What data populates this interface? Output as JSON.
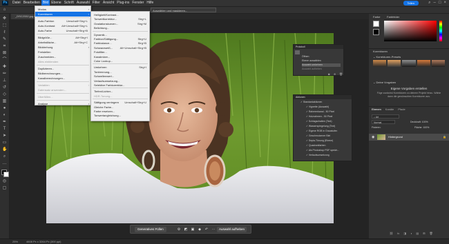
{
  "menubar": {
    "items": [
      "Datei",
      "Bearbeiten",
      "Bild",
      "Ebene",
      "Schrift",
      "Auswahl",
      "Filter",
      "Ansicht",
      "Plug-ins",
      "Fenster",
      "Hilfe"
    ],
    "active_index": 2,
    "share_label": "Teilen",
    "logo": "Ps"
  },
  "options": {
    "select_label": "Auswählen und maskieren..."
  },
  "document": {
    "tab_label": "_DSC2332.jpg @ 25%"
  },
  "image_menu": {
    "items": [
      {
        "label": "Modus",
        "shortcut": "",
        "arrow": true,
        "state": "normal"
      },
      {
        "label": "Korrekturen",
        "shortcut": "",
        "arrow": true,
        "state": "highlight"
      },
      {
        "label": "Auto-Farbton",
        "shortcut": "Umschalt+Strg+L",
        "state": "normal"
      },
      {
        "label": "Auto-Kontrast",
        "shortcut": "Alt+Umschalt+Strg+L",
        "state": "normal"
      },
      {
        "label": "Auto-Farbe",
        "shortcut": "Umschalt+Strg+B",
        "state": "normal"
      },
      {
        "label": "Bildgröße...",
        "shortcut": "Alt+Strg+I",
        "state": "normal"
      },
      {
        "label": "Arbeitsfläche...",
        "shortcut": "Alt+Strg+C",
        "state": "normal"
      },
      {
        "label": "Bilddrehung",
        "shortcut": "",
        "arrow": true,
        "state": "normal"
      },
      {
        "label": "Freistellen",
        "shortcut": "",
        "state": "normal"
      },
      {
        "label": "Zuschneiden...",
        "shortcut": "",
        "state": "normal"
      },
      {
        "label": "Alles einblenden",
        "shortcut": "",
        "state": "disabled"
      },
      {
        "label": "Duplizieren...",
        "shortcut": "",
        "state": "normal"
      },
      {
        "label": "Bildberechnungen...",
        "shortcut": "",
        "state": "normal"
      },
      {
        "label": "Kanalberechnungen...",
        "shortcut": "",
        "state": "normal"
      },
      {
        "label": "Variablen",
        "shortcut": "",
        "arrow": true,
        "state": "disabled"
      },
      {
        "label": "Datensatz anwenden...",
        "shortcut": "",
        "state": "disabled"
      },
      {
        "label": "Überfüllen...",
        "shortcut": "",
        "state": "disabled"
      },
      {
        "label": "Analyse",
        "shortcut": "",
        "arrow": true,
        "state": "normal"
      }
    ]
  },
  "adjust_menu": {
    "items": [
      {
        "label": "Helligkeit/Kontrast...",
        "shortcut": ""
      },
      {
        "label": "Tonwertkorrektur...",
        "shortcut": "Strg+L"
      },
      {
        "label": "Gradationskurven...",
        "shortcut": "Strg+M"
      },
      {
        "label": "Belichtung...",
        "shortcut": ""
      },
      {
        "label": "Dynamik...",
        "shortcut": ""
      },
      {
        "label": "Farbton/Sättigung...",
        "shortcut": "Strg+U"
      },
      {
        "label": "Farbbalance...",
        "shortcut": "Strg+B"
      },
      {
        "label": "Schwarzweiß...",
        "shortcut": "Alt+Umschalt+Strg+B"
      },
      {
        "label": "Fotofilter...",
        "shortcut": ""
      },
      {
        "label": "Kanalmixer...",
        "shortcut": ""
      },
      {
        "label": "Color Lookup...",
        "shortcut": ""
      },
      {
        "label": "Umkehren",
        "shortcut": "Strg+I"
      },
      {
        "label": "Tontrennung...",
        "shortcut": ""
      },
      {
        "label": "Schwellenwert...",
        "shortcut": ""
      },
      {
        "label": "Verlaufsumsetzung...",
        "shortcut": ""
      },
      {
        "label": "Selektive Farbkorrektur...",
        "shortcut": ""
      },
      {
        "label": "Tiefen/Lichter...",
        "shortcut": ""
      },
      {
        "label": "HDR-Tonung...",
        "shortcut": ""
      },
      {
        "label": "Sättigung verringern",
        "shortcut": "Umschalt+Strg+U"
      },
      {
        "label": "Gleiche Farbe...",
        "shortcut": ""
      },
      {
        "label": "Farbe ersetzen...",
        "shortcut": ""
      },
      {
        "label": "Tonwertangleichung...",
        "shortcut": ""
      }
    ]
  },
  "protocol_panel": {
    "title": "Protokoll",
    "rows": [
      "Öffnen",
      "Ebene auswählen",
      "Auswahl umkehren",
      "Auswahl aufheben"
    ]
  },
  "actions_panel": {
    "title": "Aktionen",
    "rows": [
      "Standardaktionen",
      "Vignette (Auswahl)",
      "Rahmenkanal - 50 Pixel",
      "Holzrahmen - 50 Pixel",
      "Schlagschatten (Text)",
      "Wasserspiegelung (Text)",
      "Eigene RGB in Graustufen",
      "Geschmolzener Blei",
      "Sepia-Tönung (Ebene)",
      "Quadrantfarben",
      "Als Photoshop PDF speich...",
      "Verlaufsumsetzung"
    ]
  },
  "dock": {
    "color_tab": "Farbe",
    "swatch_tab": "Farbfelder",
    "corrections_tab": "Korrekturen",
    "presets_label": "Korrekturen-Presets",
    "own_presets_label": "Deine Vorgaben",
    "own_presets_title": "Eigene Vorgaben erstellen",
    "own_presets_text": "Füge zunächst Korrekturen zu deinem Projekt hinzu. Wähle dann die gewünschten Korrekturen aus.",
    "layers_tabs": [
      "Ebenen",
      "Kanäle",
      "Pfade"
    ],
    "kind_label": "Art",
    "blend_mode": "Normal",
    "opacity_label": "Deckkraft: 100%",
    "fill_label": "Fläche: 100%",
    "lock_label": "Fixieren:",
    "layer_name": "Hintergrund",
    "accent": "#1473e6",
    "color_picker_hue": "#ff0000"
  },
  "ctxbar": {
    "gen_fill": "Generatives Füllen",
    "deselect": "Auswahl aufheben"
  },
  "status": {
    "zoom": "25%",
    "size": "4608 Px x 3264 Px (300 ppi)"
  }
}
